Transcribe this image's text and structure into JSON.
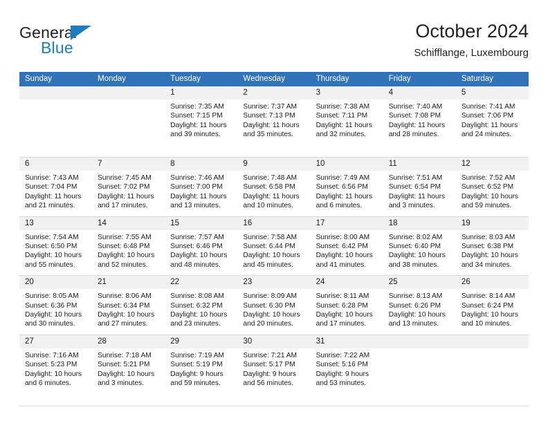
{
  "logo": {
    "word1": "General",
    "word2": "Blue",
    "icon": "triangle-logo-icon",
    "accent_color": "#1d7dc1"
  },
  "header": {
    "title": "October 2024",
    "subtitle": "Schifflange, Luxembourg",
    "header_bg_color": "#3173b8",
    "datebar_bg_color": "#f1f1f1"
  },
  "weekdays": [
    "Sunday",
    "Monday",
    "Tuesday",
    "Wednesday",
    "Thursday",
    "Friday",
    "Saturday"
  ],
  "labels": {
    "sunrise": "Sunrise:",
    "sunset": "Sunset:",
    "daylight": "Daylight:"
  },
  "weeks": [
    [
      {
        "day": "",
        "empty": true
      },
      {
        "day": "",
        "empty": true
      },
      {
        "day": "1",
        "sunrise": "Sunrise: 7:35 AM",
        "sunset": "Sunset: 7:15 PM",
        "daylight_l1": "Daylight: 11 hours",
        "daylight_l2": "and 39 minutes."
      },
      {
        "day": "2",
        "sunrise": "Sunrise: 7:37 AM",
        "sunset": "Sunset: 7:13 PM",
        "daylight_l1": "Daylight: 11 hours",
        "daylight_l2": "and 35 minutes."
      },
      {
        "day": "3",
        "sunrise": "Sunrise: 7:38 AM",
        "sunset": "Sunset: 7:11 PM",
        "daylight_l1": "Daylight: 11 hours",
        "daylight_l2": "and 32 minutes."
      },
      {
        "day": "4",
        "sunrise": "Sunrise: 7:40 AM",
        "sunset": "Sunset: 7:08 PM",
        "daylight_l1": "Daylight: 11 hours",
        "daylight_l2": "and 28 minutes."
      },
      {
        "day": "5",
        "sunrise": "Sunrise: 7:41 AM",
        "sunset": "Sunset: 7:06 PM",
        "daylight_l1": "Daylight: 11 hours",
        "daylight_l2": "and 24 minutes."
      }
    ],
    [
      {
        "day": "6",
        "sunrise": "Sunrise: 7:43 AM",
        "sunset": "Sunset: 7:04 PM",
        "daylight_l1": "Daylight: 11 hours",
        "daylight_l2": "and 21 minutes."
      },
      {
        "day": "7",
        "sunrise": "Sunrise: 7:45 AM",
        "sunset": "Sunset: 7:02 PM",
        "daylight_l1": "Daylight: 11 hours",
        "daylight_l2": "and 17 minutes."
      },
      {
        "day": "8",
        "sunrise": "Sunrise: 7:46 AM",
        "sunset": "Sunset: 7:00 PM",
        "daylight_l1": "Daylight: 11 hours",
        "daylight_l2": "and 13 minutes."
      },
      {
        "day": "9",
        "sunrise": "Sunrise: 7:48 AM",
        "sunset": "Sunset: 6:58 PM",
        "daylight_l1": "Daylight: 11 hours",
        "daylight_l2": "and 10 minutes."
      },
      {
        "day": "10",
        "sunrise": "Sunrise: 7:49 AM",
        "sunset": "Sunset: 6:56 PM",
        "daylight_l1": "Daylight: 11 hours",
        "daylight_l2": "and 6 minutes."
      },
      {
        "day": "11",
        "sunrise": "Sunrise: 7:51 AM",
        "sunset": "Sunset: 6:54 PM",
        "daylight_l1": "Daylight: 11 hours",
        "daylight_l2": "and 3 minutes."
      },
      {
        "day": "12",
        "sunrise": "Sunrise: 7:52 AM",
        "sunset": "Sunset: 6:52 PM",
        "daylight_l1": "Daylight: 10 hours",
        "daylight_l2": "and 59 minutes."
      }
    ],
    [
      {
        "day": "13",
        "sunrise": "Sunrise: 7:54 AM",
        "sunset": "Sunset: 6:50 PM",
        "daylight_l1": "Daylight: 10 hours",
        "daylight_l2": "and 55 minutes."
      },
      {
        "day": "14",
        "sunrise": "Sunrise: 7:55 AM",
        "sunset": "Sunset: 6:48 PM",
        "daylight_l1": "Daylight: 10 hours",
        "daylight_l2": "and 52 minutes."
      },
      {
        "day": "15",
        "sunrise": "Sunrise: 7:57 AM",
        "sunset": "Sunset: 6:46 PM",
        "daylight_l1": "Daylight: 10 hours",
        "daylight_l2": "and 48 minutes."
      },
      {
        "day": "16",
        "sunrise": "Sunrise: 7:58 AM",
        "sunset": "Sunset: 6:44 PM",
        "daylight_l1": "Daylight: 10 hours",
        "daylight_l2": "and 45 minutes."
      },
      {
        "day": "17",
        "sunrise": "Sunrise: 8:00 AM",
        "sunset": "Sunset: 6:42 PM",
        "daylight_l1": "Daylight: 10 hours",
        "daylight_l2": "and 41 minutes."
      },
      {
        "day": "18",
        "sunrise": "Sunrise: 8:02 AM",
        "sunset": "Sunset: 6:40 PM",
        "daylight_l1": "Daylight: 10 hours",
        "daylight_l2": "and 38 minutes."
      },
      {
        "day": "19",
        "sunrise": "Sunrise: 8:03 AM",
        "sunset": "Sunset: 6:38 PM",
        "daylight_l1": "Daylight: 10 hours",
        "daylight_l2": "and 34 minutes."
      }
    ],
    [
      {
        "day": "20",
        "sunrise": "Sunrise: 8:05 AM",
        "sunset": "Sunset: 6:36 PM",
        "daylight_l1": "Daylight: 10 hours",
        "daylight_l2": "and 30 minutes."
      },
      {
        "day": "21",
        "sunrise": "Sunrise: 8:06 AM",
        "sunset": "Sunset: 6:34 PM",
        "daylight_l1": "Daylight: 10 hours",
        "daylight_l2": "and 27 minutes."
      },
      {
        "day": "22",
        "sunrise": "Sunrise: 8:08 AM",
        "sunset": "Sunset: 6:32 PM",
        "daylight_l1": "Daylight: 10 hours",
        "daylight_l2": "and 23 minutes."
      },
      {
        "day": "23",
        "sunrise": "Sunrise: 8:09 AM",
        "sunset": "Sunset: 6:30 PM",
        "daylight_l1": "Daylight: 10 hours",
        "daylight_l2": "and 20 minutes."
      },
      {
        "day": "24",
        "sunrise": "Sunrise: 8:11 AM",
        "sunset": "Sunset: 6:28 PM",
        "daylight_l1": "Daylight: 10 hours",
        "daylight_l2": "and 17 minutes."
      },
      {
        "day": "25",
        "sunrise": "Sunrise: 8:13 AM",
        "sunset": "Sunset: 6:26 PM",
        "daylight_l1": "Daylight: 10 hours",
        "daylight_l2": "and 13 minutes."
      },
      {
        "day": "26",
        "sunrise": "Sunrise: 8:14 AM",
        "sunset": "Sunset: 6:24 PM",
        "daylight_l1": "Daylight: 10 hours",
        "daylight_l2": "and 10 minutes."
      }
    ],
    [
      {
        "day": "27",
        "sunrise": "Sunrise: 7:16 AM",
        "sunset": "Sunset: 5:23 PM",
        "daylight_l1": "Daylight: 10 hours",
        "daylight_l2": "and 6 minutes."
      },
      {
        "day": "28",
        "sunrise": "Sunrise: 7:18 AM",
        "sunset": "Sunset: 5:21 PM",
        "daylight_l1": "Daylight: 10 hours",
        "daylight_l2": "and 3 minutes."
      },
      {
        "day": "29",
        "sunrise": "Sunrise: 7:19 AM",
        "sunset": "Sunset: 5:19 PM",
        "daylight_l1": "Daylight: 9 hours",
        "daylight_l2": "and 59 minutes."
      },
      {
        "day": "30",
        "sunrise": "Sunrise: 7:21 AM",
        "sunset": "Sunset: 5:17 PM",
        "daylight_l1": "Daylight: 9 hours",
        "daylight_l2": "and 56 minutes."
      },
      {
        "day": "31",
        "sunrise": "Sunrise: 7:22 AM",
        "sunset": "Sunset: 5:16 PM",
        "daylight_l1": "Daylight: 9 hours",
        "daylight_l2": "and 53 minutes."
      },
      {
        "day": "",
        "empty": true
      },
      {
        "day": "",
        "empty": true
      }
    ]
  ]
}
